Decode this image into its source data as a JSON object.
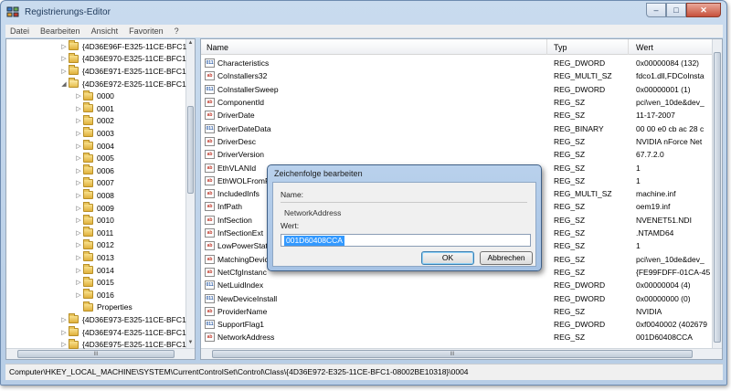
{
  "window": {
    "title": "Registrierungs-Editor"
  },
  "menu": [
    "Datei",
    "Bearbeiten",
    "Ansicht",
    "Favoriten",
    "?"
  ],
  "tree": {
    "items": [
      {
        "label": "{4D36E96F-E325-11CE-BFC1",
        "level": 0,
        "expanded": false,
        "selected": false
      },
      {
        "label": "{4D36E970-E325-11CE-BFC1",
        "level": 0,
        "expanded": false,
        "selected": false
      },
      {
        "label": "{4D36E971-E325-11CE-BFC1",
        "level": 0,
        "expanded": false,
        "selected": false
      },
      {
        "label": "{4D36E972-E325-11CE-BFC1",
        "level": 0,
        "expanded": true,
        "selected": false
      },
      {
        "label": "0000",
        "level": 1,
        "expanded": false,
        "selected": false
      },
      {
        "label": "0001",
        "level": 1,
        "expanded": false,
        "selected": false
      },
      {
        "label": "0002",
        "level": 1,
        "expanded": false,
        "selected": false
      },
      {
        "label": "0003",
        "level": 1,
        "expanded": false,
        "selected": false
      },
      {
        "label": "0004",
        "level": 1,
        "expanded": false,
        "selected": true
      },
      {
        "label": "0005",
        "level": 1,
        "expanded": false,
        "selected": false
      },
      {
        "label": "0006",
        "level": 1,
        "expanded": false,
        "selected": false
      },
      {
        "label": "0007",
        "level": 1,
        "expanded": false,
        "selected": false
      },
      {
        "label": "0008",
        "level": 1,
        "expanded": false,
        "selected": false
      },
      {
        "label": "0009",
        "level": 1,
        "expanded": false,
        "selected": false
      },
      {
        "label": "0010",
        "level": 1,
        "expanded": false,
        "selected": false
      },
      {
        "label": "0011",
        "level": 1,
        "expanded": false,
        "selected": false
      },
      {
        "label": "0012",
        "level": 1,
        "expanded": false,
        "selected": false
      },
      {
        "label": "0013",
        "level": 1,
        "expanded": false,
        "selected": false
      },
      {
        "label": "0014",
        "level": 1,
        "expanded": false,
        "selected": false
      },
      {
        "label": "0015",
        "level": 1,
        "expanded": false,
        "selected": false
      },
      {
        "label": "0016",
        "level": 1,
        "expanded": false,
        "selected": false
      },
      {
        "label": "Properties",
        "level": 1,
        "expanded": false,
        "selected": false,
        "leaf": true
      },
      {
        "label": "{4D36E973-E325-11CE-BFC1",
        "level": 0,
        "expanded": false,
        "selected": false
      },
      {
        "label": "{4D36E974-E325-11CE-BFC1",
        "level": 0,
        "expanded": false,
        "selected": false
      },
      {
        "label": "{4D36E975-E325-11CE-BFC1",
        "level": 0,
        "expanded": false,
        "selected": false
      }
    ],
    "hscroll_grip": "III"
  },
  "list": {
    "columns": [
      "Name",
      "Typ",
      "Wert"
    ],
    "rows": [
      {
        "icon": "num",
        "name": "Characteristics",
        "type": "REG_DWORD",
        "value": "0x00000084 (132)"
      },
      {
        "icon": "ab",
        "name": "CoInstallers32",
        "type": "REG_MULTI_SZ",
        "value": "fdco1.dll,FDCoInsta"
      },
      {
        "icon": "num",
        "name": "CoInstallerSweep",
        "type": "REG_DWORD",
        "value": "0x00000001 (1)"
      },
      {
        "icon": "ab",
        "name": "ComponentId",
        "type": "REG_SZ",
        "value": "pci\\ven_10de&dev_"
      },
      {
        "icon": "ab",
        "name": "DriverDate",
        "type": "REG_SZ",
        "value": "11-17-2007"
      },
      {
        "icon": "num",
        "name": "DriverDateData",
        "type": "REG_BINARY",
        "value": "00 00 e0 cb ac 28 c"
      },
      {
        "icon": "ab",
        "name": "DriverDesc",
        "type": "REG_SZ",
        "value": "NVIDIA nForce Net"
      },
      {
        "icon": "ab",
        "name": "DriverVersion",
        "type": "REG_SZ",
        "value": "67.7.2.0"
      },
      {
        "icon": "ab",
        "name": "EthVLANId",
        "type": "REG_SZ",
        "value": "1"
      },
      {
        "icon": "ab",
        "name": "EthWOLFromP",
        "type": "REG_SZ",
        "value": "1"
      },
      {
        "icon": "ab",
        "name": "IncludedInfs",
        "type": "REG_MULTI_SZ",
        "value": "machine.inf"
      },
      {
        "icon": "ab",
        "name": "InfPath",
        "type": "REG_SZ",
        "value": "oem19.inf"
      },
      {
        "icon": "ab",
        "name": "InfSection",
        "type": "REG_SZ",
        "value": "NVENET51.NDI"
      },
      {
        "icon": "ab",
        "name": "InfSectionExt",
        "type": "REG_SZ",
        "value": ".NTAMD64"
      },
      {
        "icon": "ab",
        "name": "LowPowerState",
        "type": "REG_SZ",
        "value": "1"
      },
      {
        "icon": "ab",
        "name": "MatchingDevic",
        "type": "REG_SZ",
        "value": "pci\\ven_10de&dev_"
      },
      {
        "icon": "ab",
        "name": "NetCfgInstanc",
        "type": "REG_SZ",
        "value": "{FE99FDFF-01CA-45"
      },
      {
        "icon": "num",
        "name": "NetLuidIndex",
        "type": "REG_DWORD",
        "value": "0x00000004 (4)"
      },
      {
        "icon": "num",
        "name": "NewDeviceInstall",
        "type": "REG_DWORD",
        "value": "0x00000000 (0)"
      },
      {
        "icon": "ab",
        "name": "ProviderName",
        "type": "REG_SZ",
        "value": "NVIDIA"
      },
      {
        "icon": "num",
        "name": "SupportFlag1",
        "type": "REG_DWORD",
        "value": "0xf0040002 (402679"
      },
      {
        "icon": "ab",
        "name": "NetworkAddress",
        "type": "REG_SZ",
        "value": "001D60408CCA"
      }
    ],
    "hscroll_grip": "III"
  },
  "status": {
    "path": "Computer\\HKEY_LOCAL_MACHINE\\SYSTEM\\CurrentControlSet\\Control\\Class\\{4D36E972-E325-11CE-BFC1-08002BE10318}\\0004"
  },
  "dialog": {
    "title": "Zeichenfolge bearbeiten",
    "name_label": "Name:",
    "name_value": "NetworkAddress",
    "value_label": "Wert:",
    "value_text": "001D60408CCA",
    "ok_label": "OK",
    "cancel_label": "Abbrechen"
  }
}
